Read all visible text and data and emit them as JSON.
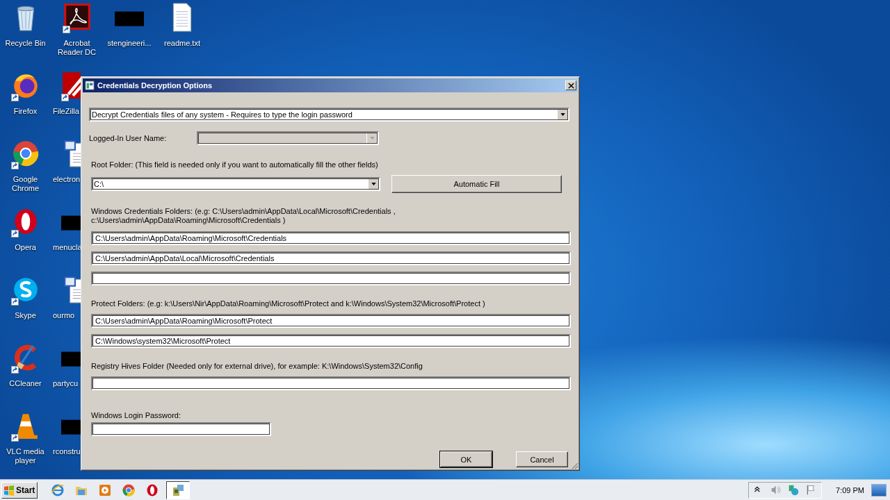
{
  "desktop": {
    "columns": [
      [
        {
          "label": "Recycle Bin",
          "kind": "recycle-bin",
          "shortcut": false,
          "partly_hidden": false
        },
        {
          "label": "Firefox",
          "kind": "firefox",
          "shortcut": true,
          "partly_hidden": false
        },
        {
          "label": "Google Chrome",
          "kind": "chrome",
          "shortcut": true,
          "partly_hidden": false
        },
        {
          "label": "Opera",
          "kind": "opera",
          "shortcut": true,
          "partly_hidden": false
        },
        {
          "label": "Skype",
          "kind": "skype",
          "shortcut": true,
          "partly_hidden": false
        },
        {
          "label": "CCleaner",
          "kind": "ccleaner",
          "shortcut": true,
          "partly_hidden": false
        },
        {
          "label": "VLC media player",
          "kind": "vlc",
          "shortcut": true,
          "partly_hidden": false
        }
      ],
      [
        {
          "label": "Acrobat Reader DC",
          "kind": "acrobat",
          "shortcut": true,
          "partly_hidden": false
        },
        {
          "label": "FileZilla",
          "kind": "filezilla",
          "shortcut": true,
          "partly_hidden": true
        },
        {
          "label": "electron",
          "kind": "word",
          "shortcut": false,
          "partly_hidden": true
        },
        {
          "label": "menucla",
          "kind": "blacked-out",
          "shortcut": false,
          "partly_hidden": true
        },
        {
          "label": "ourmo",
          "kind": "word",
          "shortcut": false,
          "partly_hidden": true
        },
        {
          "label": "partycu",
          "kind": "blacked-out",
          "shortcut": false,
          "partly_hidden": true
        },
        {
          "label": "rconstru",
          "kind": "blacked-out",
          "shortcut": false,
          "partly_hidden": true
        }
      ],
      [
        {
          "label": "stengineeri...",
          "kind": "blacked-out",
          "shortcut": false,
          "partly_hidden": false
        }
      ],
      [
        {
          "label": "readme.txt",
          "kind": "text-file",
          "shortcut": false,
          "partly_hidden": false
        }
      ]
    ]
  },
  "dialog": {
    "title": "Credentials Decryption Options",
    "mode": {
      "value": "Decrypt Credentials files of any system - Requires to type the login password"
    },
    "user_name": {
      "label": "Logged-In User Name:",
      "disabled": true
    },
    "root_folder": {
      "label": "Root Folder: (This field is needed only if you want to automatically fill the other fields)",
      "value": "C:\\"
    },
    "automatic_fill_button": "Automatic Fill",
    "credentials_folders": {
      "label": "Windows Credentials Folders:  (e.g: C:\\Users\\admin\\AppData\\Local\\Microsoft\\Credentials , c:\\Users\\admin\\AppData\\Roaming\\Microsoft\\Credentials )",
      "values": [
        "C:\\Users\\admin\\AppData\\Roaming\\Microsoft\\Credentials",
        "C:\\Users\\admin\\AppData\\Local\\Microsoft\\Credentials"
      ]
    },
    "protect_folders": {
      "label": "Protect Folders: (e.g: k:\\Users\\Nir\\AppData\\Roaming\\Microsoft\\Protect and k:\\Windows\\System32\\Microsoft\\Protect )",
      "values": [
        "C:\\Users\\admin\\AppData\\Roaming\\Microsoft\\Protect",
        "C:\\Windows\\system32\\Microsoft\\Protect"
      ]
    },
    "registry_folder": {
      "label": "Registry Hives Folder (Needed only for external drive), for example:  K:\\Windows\\System32\\Config"
    },
    "password": {
      "label": "Windows Login Password:"
    },
    "buttons": [
      {
        "label": "OK",
        "selected": true
      },
      {
        "label": "Cancel",
        "selected": false
      }
    ]
  },
  "taskbar": {
    "start_button": "Start",
    "apps": [
      {
        "kind": "ie",
        "selected": false
      },
      {
        "kind": "folder",
        "selected": false
      },
      {
        "kind": "media",
        "selected": false
      },
      {
        "kind": "chrome",
        "selected": false
      },
      {
        "kind": "opera",
        "selected": false
      },
      {
        "kind": "app",
        "selected": true
      }
    ],
    "tray": [
      {
        "kind": "chevron"
      },
      {
        "kind": "speaker"
      },
      {
        "kind": "network"
      },
      {
        "kind": "flag"
      }
    ],
    "clock": "7:09 PM"
  }
}
